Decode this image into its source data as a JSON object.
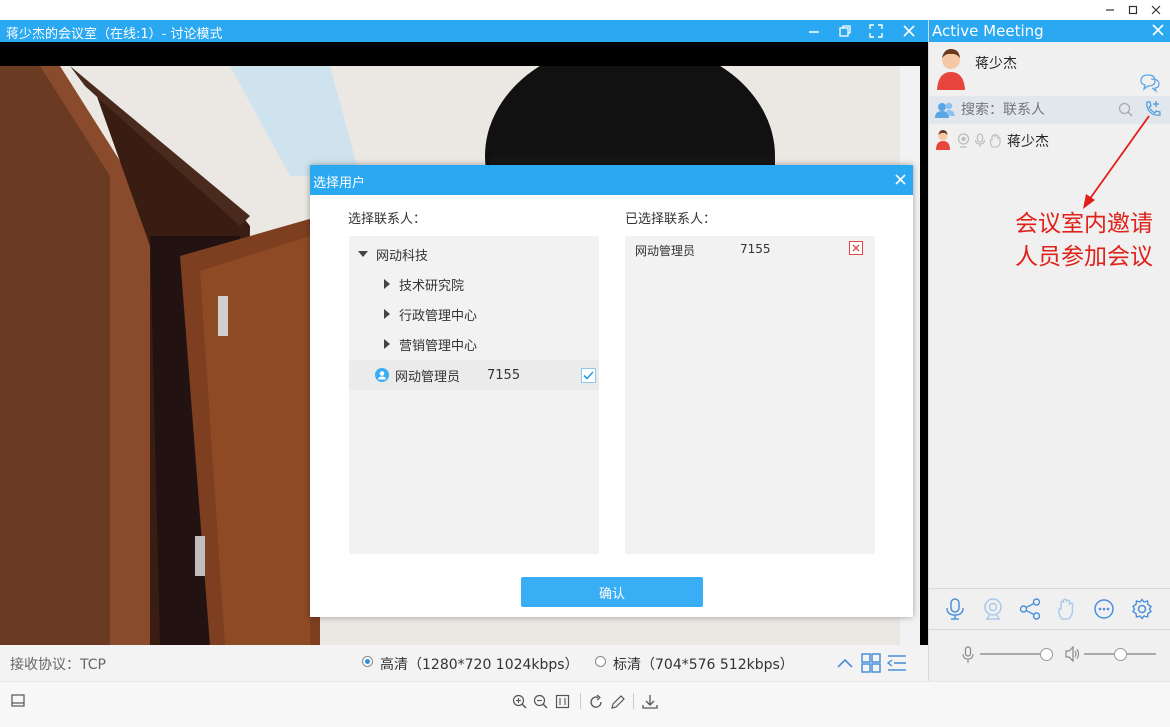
{
  "window": {
    "title": "蒋少杰的会议室（在线:1）- 讨论模式"
  },
  "video": {
    "receive_protocol": "接收协议：TCP"
  },
  "quality": {
    "hd_label": "高清",
    "hd_detail": "（1280*720 1024kbps）",
    "sd_label": "标清",
    "sd_detail": "（704*576 512kbps）",
    "selected": "高清"
  },
  "panel": {
    "title": "Active Meeting",
    "host_name": "蒋少杰",
    "search_placeholder": "搜索：联系人",
    "participants": [
      {
        "name": "蒋少杰"
      }
    ],
    "annotation_line1": "会议室内邀请",
    "annotation_line2": "人员参加会议",
    "annotation_color": "#e0201a"
  },
  "dialog": {
    "title": "选择用户",
    "left_heading": "选择联系人：",
    "right_heading": "已选择联系人：",
    "tree": {
      "root": "网动科技",
      "groups": [
        "技术研究院",
        "行政管理中心",
        "营销管理中心"
      ],
      "user": {
        "name": "网动管理员",
        "id": "7155",
        "checked": true
      }
    },
    "selected": [
      {
        "name": "网动管理员",
        "id": "7155"
      }
    ],
    "confirm_label": "确认"
  },
  "colors": {
    "accent": "#2aa8f1",
    "button": "#3aaef5",
    "remove": "#e04848"
  }
}
